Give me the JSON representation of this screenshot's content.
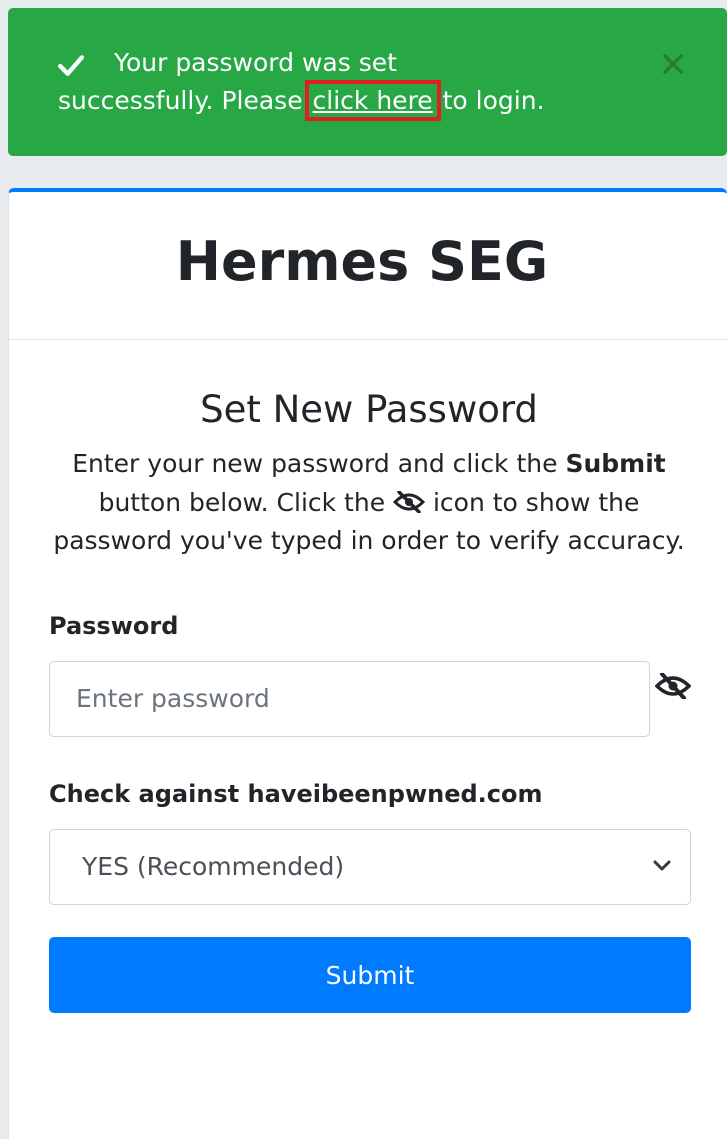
{
  "alert": {
    "icon": "check-icon",
    "text_line1": "Your password was set",
    "text_before_link": "successfully. Please ",
    "link_text": "click here",
    "text_after_link": " to login.",
    "close_icon": "close-icon",
    "color": "#28a745"
  },
  "card": {
    "header_title": "Hermes SEG",
    "title": "Set New Password",
    "desc_part1": "Enter your new password and click the ",
    "desc_bold": "Submit",
    "desc_part2": " button below. Click the ",
    "desc_icon": "eye-slash-icon",
    "desc_part3": " icon to show the password you've typed in order to verify accuracy.",
    "accent": "#007bff"
  },
  "form": {
    "password_label": "Password",
    "password_placeholder": "Enter password",
    "password_value": "",
    "toggle_icon": "eye-slash-icon",
    "hibp_label": "Check against haveibeenpwned.com",
    "hibp_selected": "YES (Recommended)",
    "submit_label": "Submit"
  }
}
